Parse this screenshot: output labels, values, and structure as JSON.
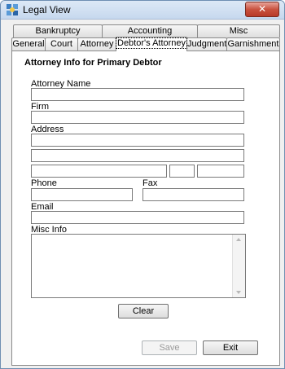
{
  "window": {
    "title": "Legal View",
    "close_glyph": "✕"
  },
  "tabs": {
    "back_row": [
      "Bankruptcy",
      "Accounting",
      "Misc"
    ],
    "front_row": [
      "General",
      "Court",
      "Attorney",
      "Debtor's Attorney",
      "Judgment",
      "Garnishment"
    ],
    "active": "Debtor's Attorney"
  },
  "panel": {
    "heading": "Attorney Info for Primary Debtor",
    "labels": {
      "attorney_name": "Attorney Name",
      "firm": "Firm",
      "address": "Address",
      "phone": "Phone",
      "fax": "Fax",
      "email": "Email",
      "misc_info": "Misc Info"
    },
    "values": {
      "attorney_name": "",
      "firm": "",
      "address1": "",
      "address2": "",
      "city": "",
      "state": "",
      "zip": "",
      "phone": "",
      "fax": "",
      "email": "",
      "misc_info": ""
    },
    "clear_label": "Clear"
  },
  "footer": {
    "save_label": "Save",
    "exit_label": "Exit",
    "save_enabled": false
  }
}
